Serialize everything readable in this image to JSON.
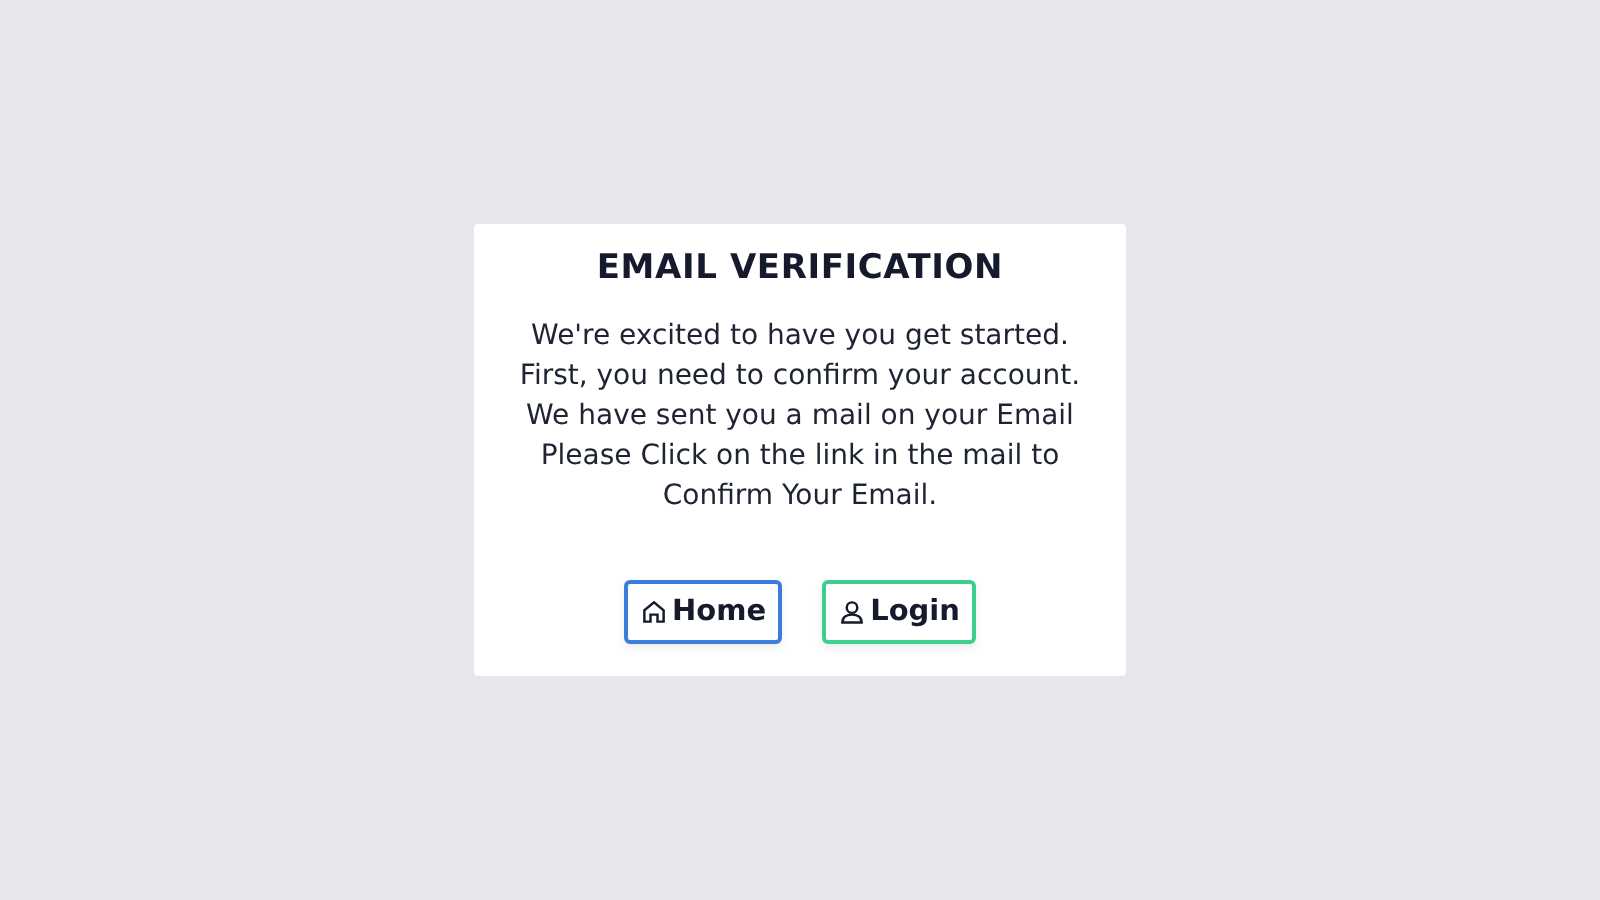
{
  "card": {
    "title": "EMAIL VERIFICATION",
    "message_lines": [
      "We're excited to have you get started.",
      "First, you need to confirm your account.",
      "We have sent you a mail on your Email",
      "Please Click on the link in the mail to",
      "Confirm Your Email."
    ],
    "buttons": [
      {
        "label": "Home",
        "kind": "home",
        "color": "#3b7ddd"
      },
      {
        "label": "Login",
        "kind": "login",
        "color": "#3ecf8e"
      }
    ]
  }
}
